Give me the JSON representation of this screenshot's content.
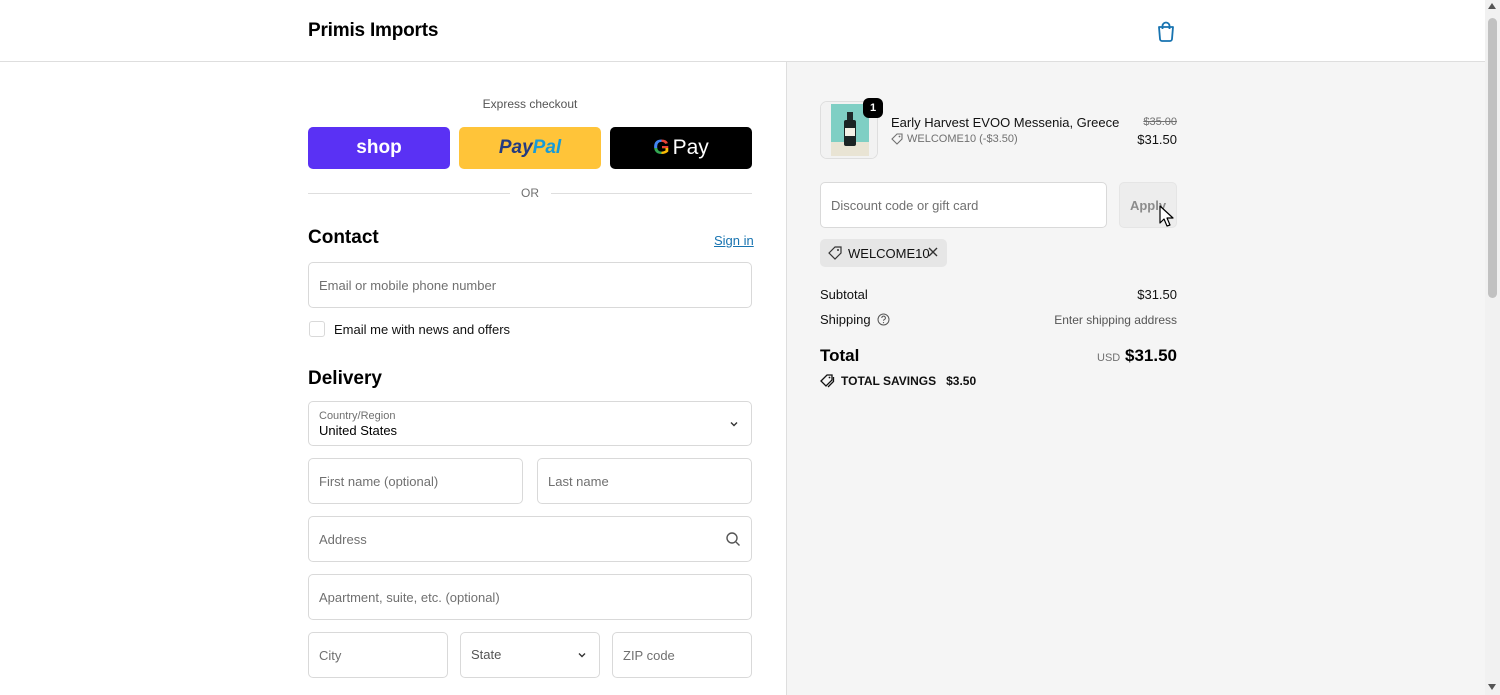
{
  "header": {
    "store_name": "Primis Imports",
    "cart_icon": "shopping-bag-icon"
  },
  "express": {
    "label": "Express checkout",
    "shop_label": "shop",
    "paypal_label_a": "Pay",
    "paypal_label_b": "Pal",
    "gpay_g": "G",
    "gpay_label": "Pay",
    "or_text": "OR"
  },
  "contact": {
    "title": "Contact",
    "sign_in": "Sign in",
    "email_placeholder": "Email or mobile phone number",
    "newsletter_label": "Email me with news and offers"
  },
  "delivery": {
    "title": "Delivery",
    "country_label": "Country/Region",
    "country_value": "United States",
    "first_name_placeholder": "First name (optional)",
    "last_name_placeholder": "Last name",
    "address_placeholder": "Address",
    "apartment_placeholder": "Apartment, suite, etc. (optional)",
    "city_placeholder": "City",
    "state_label": "State",
    "zip_placeholder": "ZIP code"
  },
  "order": {
    "item": {
      "quantity": "1",
      "name": "Early Harvest EVOO Messenia, Greece",
      "discount": "WELCOME10 (-$3.50)",
      "original_price": "$35.00",
      "price": "$31.50"
    },
    "discount_placeholder": "Discount code or gift card",
    "apply_label": "Apply",
    "applied_code": "WELCOME10",
    "subtotal_label": "Subtotal",
    "subtotal_value": "$31.50",
    "shipping_label": "Shipping",
    "shipping_value": "Enter shipping address",
    "total_label": "Total",
    "currency": "USD",
    "total_value": "$31.50",
    "savings_label": "TOTAL SAVINGS",
    "savings_value": "$3.50"
  },
  "colors": {
    "shop_purple": "#5a31f4",
    "paypal_yellow": "#ffc439",
    "link_blue": "#1773b0",
    "summary_bg": "#f5f5f5"
  }
}
